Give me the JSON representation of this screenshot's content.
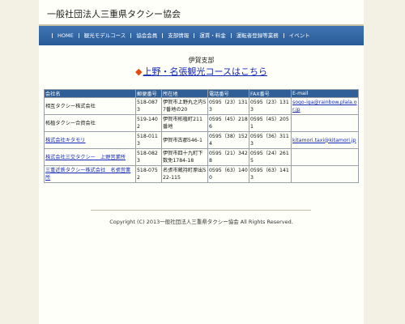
{
  "site": {
    "title": "一般社団法人三重県タクシー協会"
  },
  "nav": {
    "items": [
      "HOME",
      "観光モデルコース",
      "協会会員",
      "支部情報",
      "運賃・料金",
      "運転者登録等業務",
      "イベント"
    ]
  },
  "main": {
    "branch_title": "伊賀支部",
    "course_link": "上野・名張観光コースはこちら",
    "table": {
      "headers": [
        "会社名",
        "郵便番号",
        "所在地",
        "電話番号",
        "FAX番号",
        "E-mail"
      ],
      "rows": [
        [
          "相互タクシー株式会社",
          "518-0873",
          "伊賀市上野丸之内57番地の20",
          "0595（23）1313",
          "0595（23）1313",
          "sogo-iga@rainbow.plala.or.jp"
        ],
        [
          "柘植タクシー合資会社",
          "519-1402",
          "伊賀市柘植町211番地",
          "0595（45）2186",
          "0595（45）2051",
          ""
        ],
        [
          "株式会社キタモリ",
          "518-0113",
          "伊賀市古郡546-1",
          "0595（38）1524",
          "0595（36）3113",
          "kitamori.taxi@kitamori.jp"
        ],
        [
          "株式会社三交タクシー　上野営業所",
          "518-0823",
          "伊賀市四十九町下数免1784-18",
          "0595（21）3428",
          "0595（24）2615",
          ""
        ],
        [
          "三重近鉄タクシー株式会社　名張営業所",
          "518-0752",
          "名張市蔵持町原出522-115",
          "0595（63）1400",
          "0595（63）1413",
          ""
        ]
      ]
    }
  },
  "footer": {
    "copyright": "Copyright (C) 2013一般社団法人三重県タクシー協会 All Rights Reserved."
  }
}
